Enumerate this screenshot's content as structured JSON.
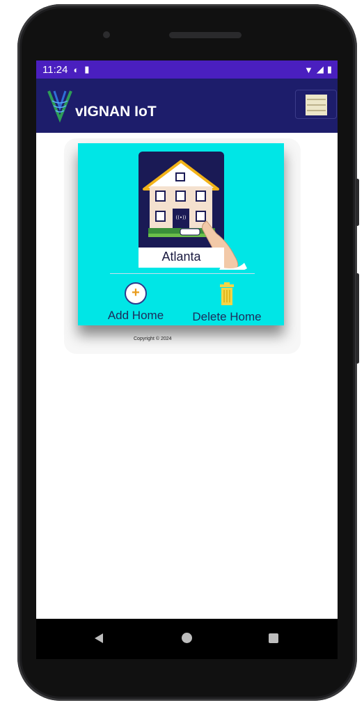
{
  "status_bar": {
    "time": "11:24",
    "icons": [
      "data-saver-icon",
      "sd-card-icon",
      "wifi-icon",
      "signal-icon",
      "battery-icon"
    ]
  },
  "app_bar": {
    "title": "vIGNAN IoT",
    "logo": "vignan-v-logo",
    "menu_icon": "hamburger-menu-icon"
  },
  "homes": [
    {
      "name": "Atlanta",
      "image": "smart-home-illustration"
    }
  ],
  "actions": {
    "add_label": "Add Home",
    "delete_label": "Delete Home"
  },
  "footer": {
    "copyright": "Copyright © 2024"
  },
  "colors": {
    "status_bar": "#4a1fbf",
    "app_bar": "#1d1d6b",
    "card": "#00e6e6",
    "accent": "#e89a1a"
  },
  "nav_bar": {
    "buttons": [
      "back-icon",
      "home-icon",
      "recents-icon"
    ]
  }
}
